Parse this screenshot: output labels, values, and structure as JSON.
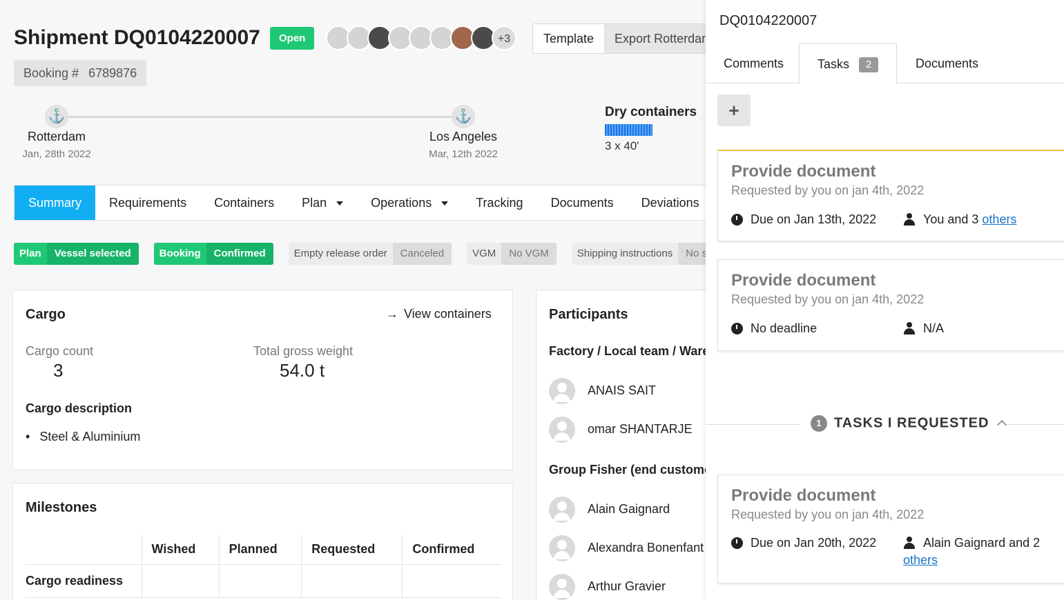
{
  "shipment": {
    "title": "Shipment DQ0104220007",
    "status": "Open",
    "more_collaborators": "+3",
    "template_button": "Template",
    "export_button": "Export Rotterdam",
    "booking_label": "Booking #",
    "booking_value": "6789876"
  },
  "route": {
    "origin": {
      "name": "Rotterdam",
      "date": "Jan, 28th 2022"
    },
    "destination": {
      "name": "Los Angeles",
      "date": "Mar, 12th 2022"
    },
    "containers_title": "Dry containers",
    "containers_qty": "3 x 40'"
  },
  "tabs": [
    {
      "label": "Summary"
    },
    {
      "label": "Requirements"
    },
    {
      "label": "Containers"
    },
    {
      "label": "Plan"
    },
    {
      "label": "Operations"
    },
    {
      "label": "Tracking"
    },
    {
      "label": "Documents"
    },
    {
      "label": "Deviations"
    }
  ],
  "status_pills": [
    {
      "key": "Plan",
      "value": "Vessel selected"
    },
    {
      "key": "Booking",
      "value": "Confirmed"
    },
    {
      "key": "Empty release order",
      "value": "Canceled"
    },
    {
      "key": "VGM",
      "value": "No VGM"
    },
    {
      "key": "Shipping instructions",
      "value": "No sh"
    }
  ],
  "cargo": {
    "title": "Cargo",
    "view_link": "View containers",
    "count_label": "Cargo count",
    "count_value": "3",
    "weight_label": "Total gross weight",
    "weight_value": "54.0 t",
    "desc_label": "Cargo description",
    "desc_item": "Steel & Aluminium"
  },
  "milestones": {
    "title": "Milestones",
    "columns": [
      "Wished",
      "Planned",
      "Requested",
      "Confirmed"
    ],
    "row_label": "Cargo readiness"
  },
  "participants": {
    "title": "Participants",
    "group1": "Factory / Local team / Wareh",
    "group1_members": [
      "ANAIS SAIT",
      "omar SHANTARJE"
    ],
    "group2": "Group Fisher (end customer)",
    "group2_members": [
      "Alain Gaignard",
      "Alexandra Bonenfant",
      "Arthur Gravier"
    ]
  },
  "panel": {
    "title": "DQ0104220007",
    "tabs": {
      "comments": "Comments",
      "tasks": "Tasks",
      "tasks_count": "2",
      "documents": "Documents"
    },
    "add_button": "+",
    "tasks": [
      {
        "title": "Provide document",
        "requested": "Requested by you on jan 4th, 2022",
        "due": "Due on Jan 13th, 2022",
        "assignee": "You and 3 ",
        "assignee_link": "others"
      },
      {
        "title": "Provide document",
        "requested": "Requested by you on jan 4th, 2022",
        "due": "No deadline",
        "assignee": "N/A",
        "assignee_link": ""
      }
    ],
    "requested_header": "TASKS I REQUESTED",
    "requested_count": "1",
    "requested_tasks": [
      {
        "title": "Provide document",
        "requested": "Requested by you on jan 4th, 2022",
        "due": "Due on Jan 20th, 2022",
        "assignee": "Alain Gaignard and 2",
        "assignee_link": "others"
      }
    ]
  }
}
